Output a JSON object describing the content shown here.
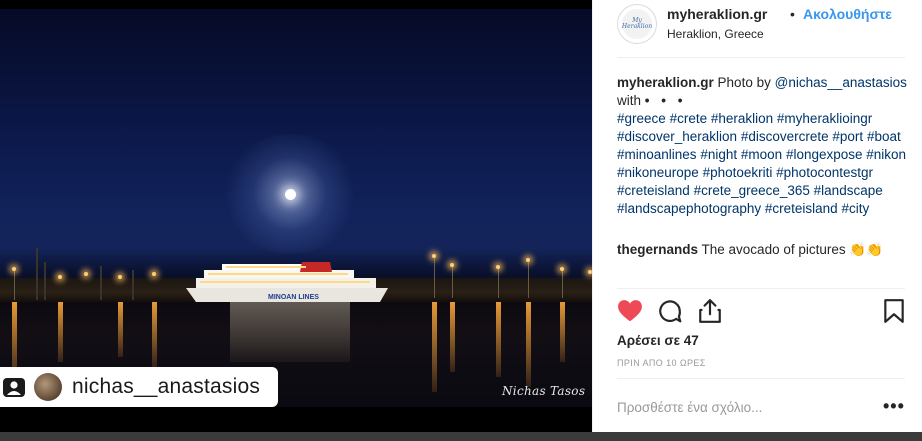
{
  "post": {
    "username": "myheraklion.gr",
    "separator": "•",
    "follow_label": "Ακολουθήστε",
    "location": "Heraklion, Greece",
    "avatar_text": "My Heraklion"
  },
  "photo": {
    "watermark": "Nichas Tasos",
    "tagged_user": "nichas__anastasios",
    "ship_text": "MINOAN LINES"
  },
  "caption": {
    "username": "myheraklion.gr",
    "text_before": "Photo by",
    "mention": "@nichas__anastasios",
    "with_word": "with",
    "with_dots": "• • •",
    "hashtags": [
      "#greece",
      "#crete",
      "#heraklion",
      "#myheraklioingr",
      "#discover_heraklion",
      "#discovercrete",
      "#port",
      "#boat",
      "#minoanlines",
      "#night",
      "#moon",
      "#longexpose",
      "#nikon",
      "#nikoneurope",
      "#photoekriti",
      "#photocontestgr",
      "#creteisland",
      "#crete_greece_365",
      "#landscape",
      "#landscapephotography",
      "#creteisland",
      "#city"
    ]
  },
  "comments": [
    {
      "username": "thegernands",
      "text": "The avocado of pictures 👏👏"
    }
  ],
  "engagement": {
    "likes_label": "Αρέσει σε 47",
    "time_ago": "ΠΡΙΝ ΑΠΟ 10 ΩΡΕΣ"
  },
  "add_comment": {
    "placeholder": "Προσθέστε ένα σχόλιο...",
    "more_label": "•••"
  },
  "icons": {
    "like": "heart-icon",
    "comment": "comment-icon",
    "share": "share-icon",
    "save": "bookmark-icon",
    "tag": "user-tag-icon"
  },
  "colors": {
    "like_red": "#ed4956",
    "follow_blue": "#3897f0",
    "hashtag_blue": "#003569"
  }
}
